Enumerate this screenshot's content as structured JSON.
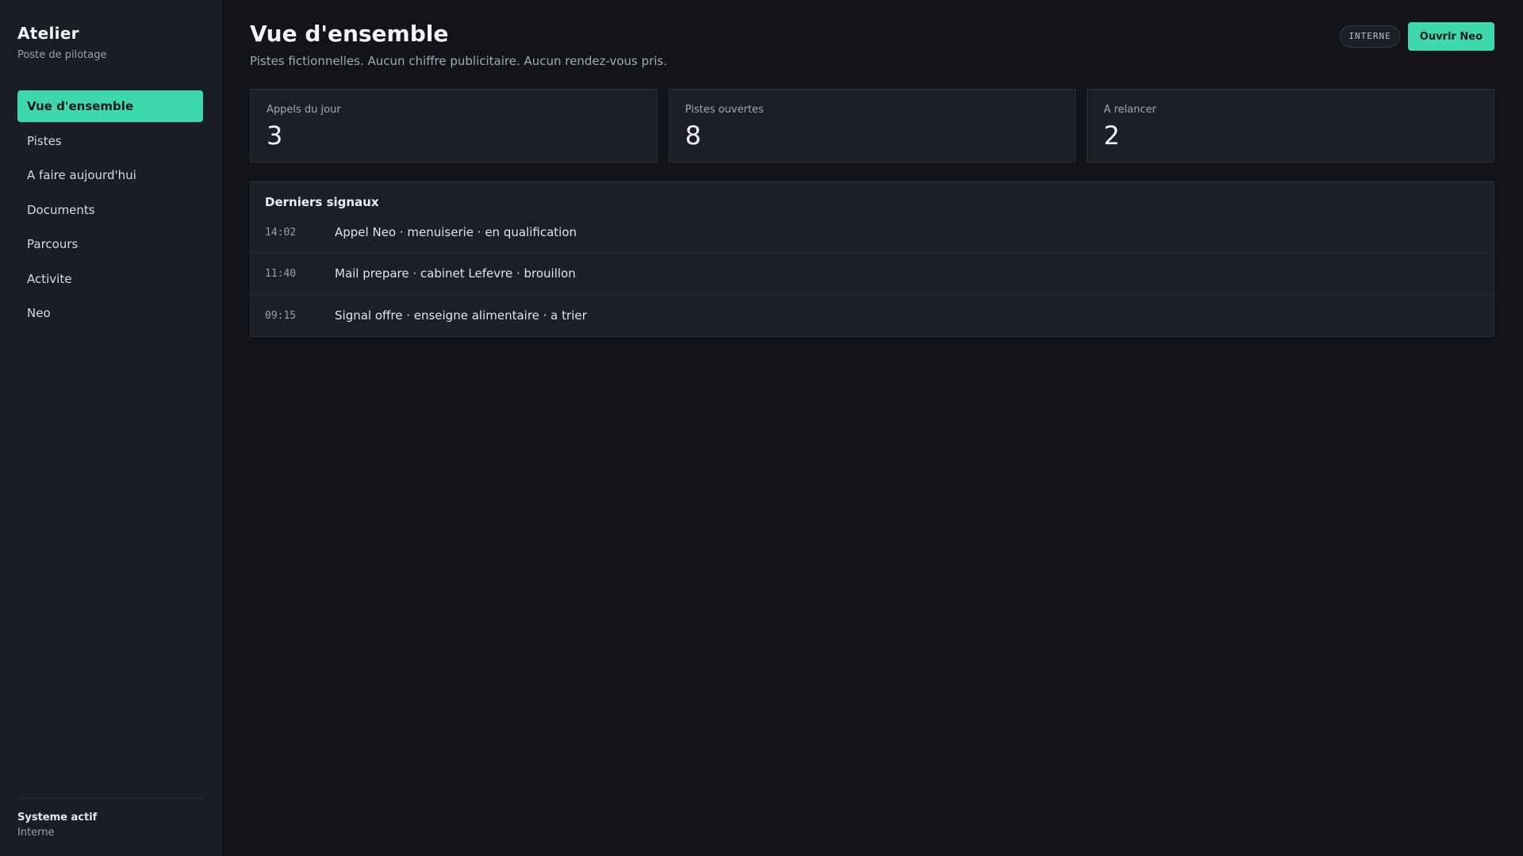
{
  "sidebar": {
    "brand": "Atelier",
    "subtitle": "Poste de pilotage",
    "items": [
      {
        "label": "Vue d'ensemble",
        "active": true
      },
      {
        "label": "Pistes",
        "active": false
      },
      {
        "label": "A faire aujourd'hui",
        "active": false
      },
      {
        "label": "Documents",
        "active": false
      },
      {
        "label": "Parcours",
        "active": false
      },
      {
        "label": "Activite",
        "active": false
      },
      {
        "label": "Neo",
        "active": false
      }
    ],
    "footer": {
      "title": "Systeme actif",
      "subtitle": "Interne"
    }
  },
  "header": {
    "title": "Vue d'ensemble",
    "subtitle": "Pistes fictionnelles. Aucun chiffre publicitaire. Aucun rendez-vous pris.",
    "badge": "INTERNE",
    "primary_button": "Ouvrir Neo"
  },
  "stats": [
    {
      "label": "Appels du jour",
      "value": "3"
    },
    {
      "label": "Pistes ouvertes",
      "value": "8"
    },
    {
      "label": "A relancer",
      "value": "2"
    }
  ],
  "signals": {
    "title": "Derniers signaux",
    "rows": [
      {
        "time": "14:02",
        "text": "Appel Neo · menuiserie · en qualification"
      },
      {
        "time": "11:40",
        "text": "Mail prepare · cabinet Lefevre · brouillon"
      },
      {
        "time": "09:15",
        "text": "Signal offre · enseigne alimentaire · a trier"
      }
    ]
  },
  "colors": {
    "accent": "#3dd9ad",
    "background": "#131419",
    "sidebar": "#1a1d25",
    "card": "#1c1f27"
  }
}
